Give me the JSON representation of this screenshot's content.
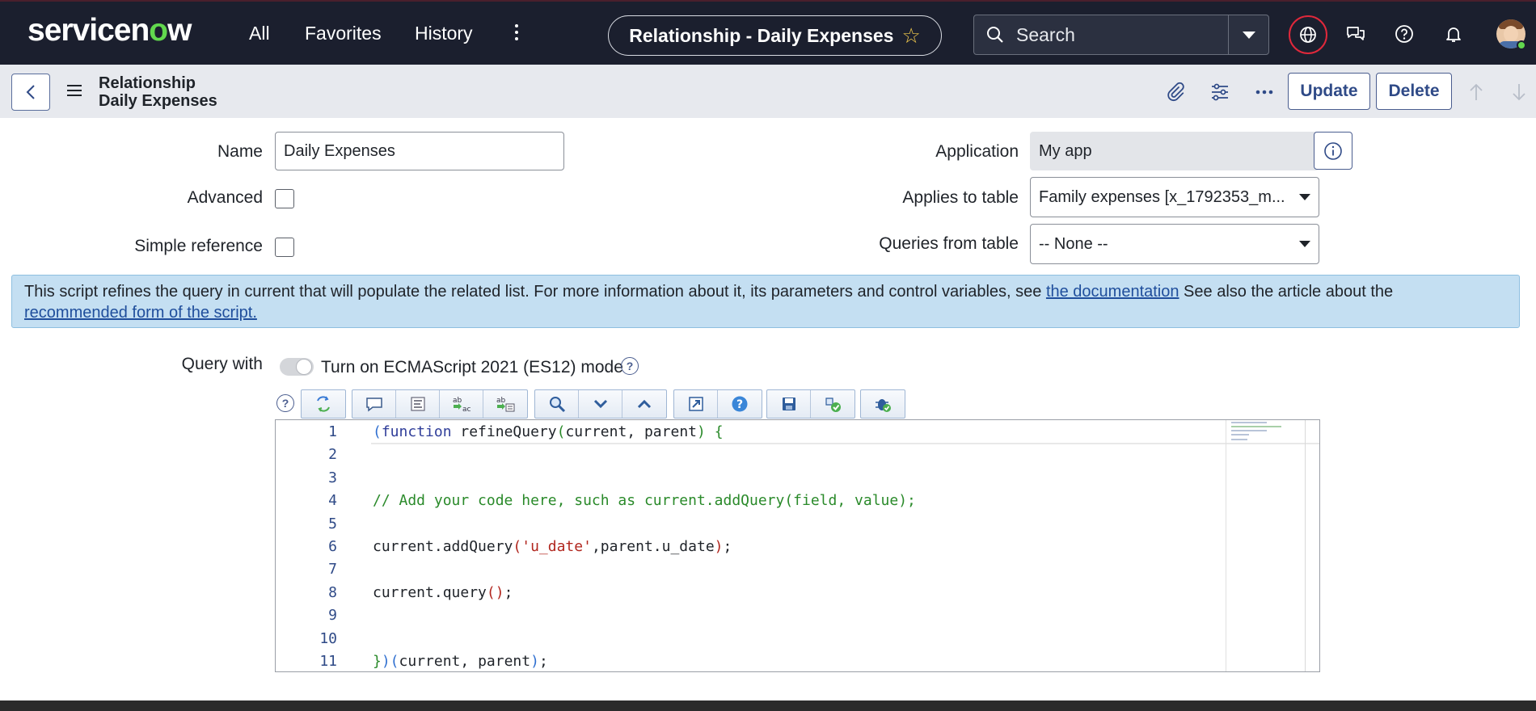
{
  "nav": {
    "logo": "servicenow",
    "links": [
      "All",
      "Favorites",
      "History"
    ],
    "record_title": "Relationship - Daily Expenses",
    "search_placeholder": "Search"
  },
  "record": {
    "type": "Relationship",
    "name": "Daily Expenses",
    "update_label": "Update",
    "delete_label": "Delete"
  },
  "form": {
    "name_label": "Name",
    "name_value": "Daily Expenses",
    "advanced_label": "Advanced",
    "simple_reference_label": "Simple reference",
    "application_label": "Application",
    "application_value": "My app",
    "applies_to_label": "Applies to table",
    "applies_to_value": "Family expenses [x_1792353_m...",
    "queries_from_label": "Queries from table",
    "queries_from_value": "-- None --",
    "advanced_checked": false,
    "simple_reference_checked": false
  },
  "banner": {
    "text1": "This script refines the query in current that will populate the related list. For more information about it, its parameters and control variables, see ",
    "link1": "the documentation",
    "text2": " See also the article about the",
    "link2": "recommended form of the script."
  },
  "script": {
    "label": "Query with",
    "toggle_label": "Turn on ECMAScript 2021 (ES12) mode",
    "toggle_on": false,
    "line_numbers": [
      "1",
      "2",
      "3",
      "4",
      "5",
      "6",
      "7",
      "8",
      "9",
      "10",
      "11"
    ]
  },
  "colors": {
    "nav_bg": "#1b1f2e",
    "accent": "#62d84e",
    "banner_bg": "#c4dff2",
    "button_text": "#2f4a87",
    "alert_ring": "#e0283b"
  }
}
